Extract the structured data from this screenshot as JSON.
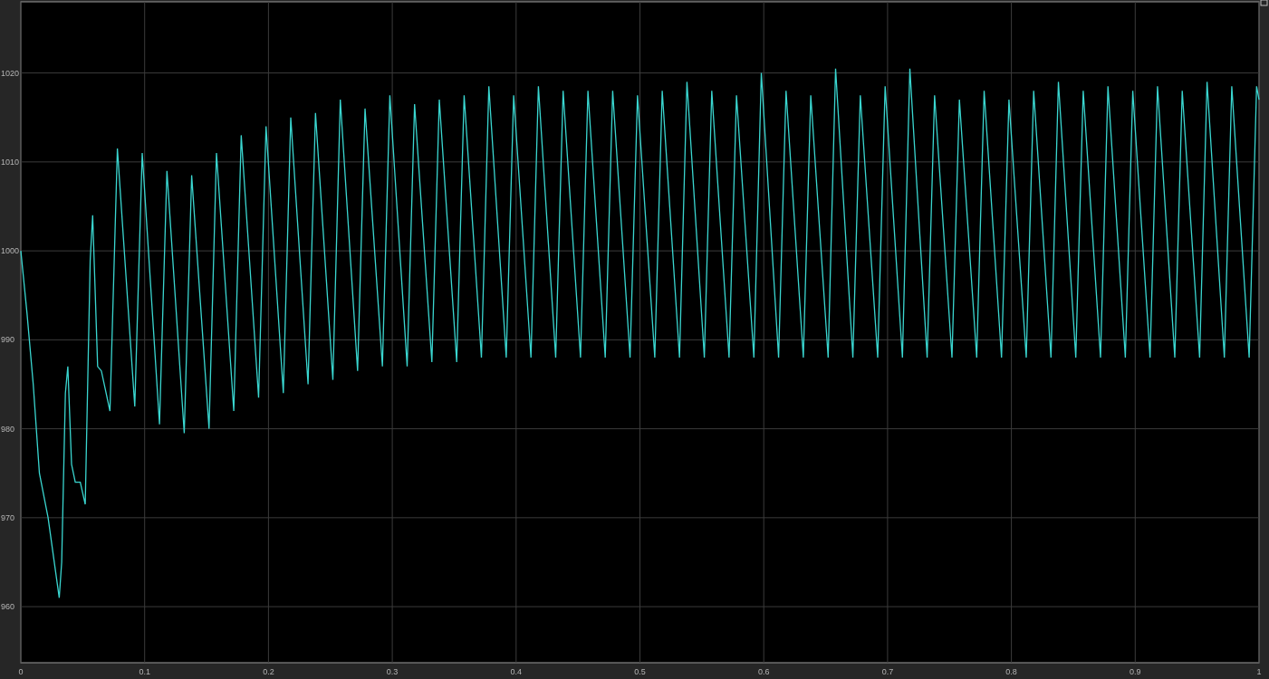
{
  "scope": {
    "chart_data": {
      "type": "line",
      "grid": true,
      "xlim": [
        0,
        1
      ],
      "ylim": [
        953.7,
        1028
      ],
      "xticks": [
        0,
        0.1,
        0.2,
        0.3,
        0.4,
        0.5,
        0.6,
        0.7,
        0.8,
        0.9,
        1
      ],
      "yticks": [
        960,
        970,
        980,
        990,
        1000,
        1010,
        1020
      ],
      "series": [
        {
          "color": "#3ad6d0",
          "x": [
            0,
            0.005,
            0.01,
            0.015,
            0.022,
            0.028,
            0.031,
            0.033,
            0.036,
            0.038,
            0.041,
            0.044,
            0.048,
            0.052,
            0.056,
            0.058,
            0.062,
            0.065,
            0.072,
            0.078,
            0.092,
            0.098,
            0.112,
            0.118,
            0.132,
            0.138,
            0.152,
            0.158,
            0.172,
            0.178,
            0.192,
            0.198,
            0.212,
            0.218,
            0.232,
            0.238,
            0.252,
            0.258,
            0.272,
            0.278,
            0.292,
            0.298,
            0.312,
            0.318,
            0.332,
            0.338,
            0.352,
            0.358,
            0.372,
            0.378,
            0.392,
            0.398,
            0.412,
            0.418,
            0.432,
            0.438,
            0.452,
            0.458,
            0.472,
            0.478,
            0.492,
            0.498,
            0.512,
            0.518,
            0.532,
            0.538,
            0.552,
            0.558,
            0.572,
            0.578,
            0.592,
            0.598,
            0.612,
            0.618,
            0.632,
            0.638,
            0.652,
            0.658,
            0.672,
            0.678,
            0.692,
            0.698,
            0.712,
            0.718,
            0.732,
            0.738,
            0.752,
            0.758,
            0.772,
            0.778,
            0.792,
            0.798,
            0.812,
            0.818,
            0.832,
            0.838,
            0.852,
            0.858,
            0.872,
            0.878,
            0.892,
            0.898,
            0.912,
            0.918,
            0.932,
            0.938,
            0.952,
            0.958,
            0.972,
            0.978,
            0.992,
            0.998,
            1
          ],
          "values": [
            1000,
            993,
            985,
            975,
            970,
            964,
            961,
            965,
            984,
            987,
            976,
            974,
            974,
            971.5,
            999,
            1004,
            987,
            986.5,
            982,
            1011.5,
            982.5,
            1011,
            980.5,
            1009,
            979.5,
            1008.5,
            980,
            1011,
            982,
            1013,
            983.5,
            1014,
            984,
            1015,
            985,
            1015.5,
            985.5,
            1017,
            986.5,
            1016,
            987,
            1017.5,
            987,
            1016.5,
            987.5,
            1017,
            987.5,
            1017.5,
            988,
            1018.5,
            988,
            1017.5,
            988,
            1018.5,
            988,
            1018,
            988,
            1018,
            988,
            1018,
            988,
            1017.5,
            988,
            1018,
            988,
            1019,
            988,
            1018,
            988,
            1017.5,
            988,
            1020,
            988,
            1018,
            988,
            1017.5,
            988,
            1020.5,
            988,
            1017.5,
            988,
            1018.5,
            988,
            1020.5,
            988,
            1017.5,
            988,
            1017,
            988,
            1018,
            988,
            1017,
            988,
            1018,
            988,
            1019,
            988,
            1018,
            988,
            1018.5,
            988,
            1018,
            988,
            1018.5,
            988,
            1018,
            988,
            1019,
            988,
            1018.5,
            988,
            1018.5,
            1017
          ]
        }
      ]
    }
  }
}
